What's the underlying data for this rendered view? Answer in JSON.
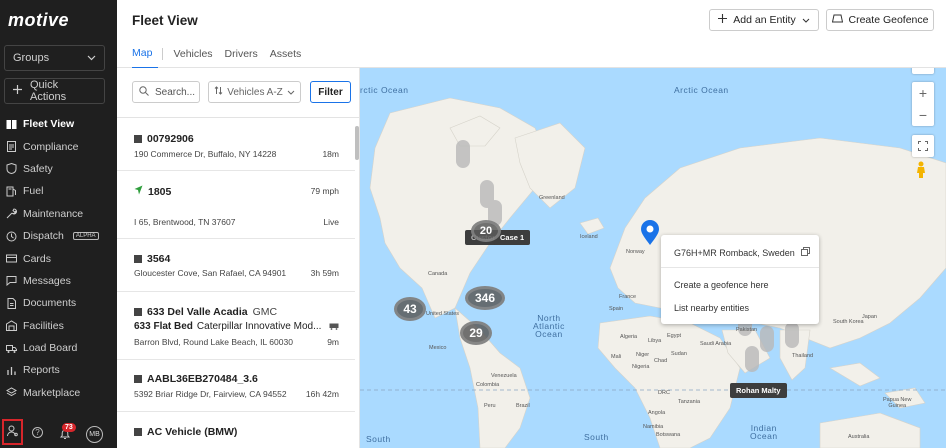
{
  "sidebar": {
    "logo": "motive",
    "groups_label": "Groups",
    "quick_actions_label": "Quick Actions",
    "items": [
      {
        "label": "Fleet View",
        "icon": "map-book-icon",
        "active": true
      },
      {
        "label": "Compliance",
        "icon": "document-icon"
      },
      {
        "label": "Safety",
        "icon": "shield-icon"
      },
      {
        "label": "Fuel",
        "icon": "fuel-icon"
      },
      {
        "label": "Maintenance",
        "icon": "wrench-icon"
      },
      {
        "label": "Dispatch",
        "icon": "dispatch-icon",
        "badge": "ALPHA"
      },
      {
        "label": "Cards",
        "icon": "card-icon"
      },
      {
        "label": "Messages",
        "icon": "message-icon"
      },
      {
        "label": "Documents",
        "icon": "file-icon"
      },
      {
        "label": "Facilities",
        "icon": "facility-icon"
      },
      {
        "label": "Load Board",
        "icon": "truck-icon"
      },
      {
        "label": "Reports",
        "icon": "report-icon"
      },
      {
        "label": "Marketplace",
        "icon": "marketplace-icon"
      }
    ],
    "notifications_count": "73",
    "avatar_initials": "MB",
    "help_glyph": "?"
  },
  "header": {
    "title": "Fleet View",
    "add_entity_label": "Add an Entity",
    "create_geofence_label": "Create Geofence",
    "tabs": [
      {
        "label": "Map",
        "active": true
      },
      {
        "label": "Vehicles"
      },
      {
        "label": "Drivers"
      },
      {
        "label": "Assets"
      }
    ]
  },
  "list": {
    "search_placeholder": "Search...",
    "sort_label": "Vehicles A-Z",
    "filter_label": "Filter",
    "items": [
      {
        "name": "00792906",
        "address": "190 Commerce Dr, Buffalo, NY 14228",
        "status": "18m",
        "icon": "square-icon"
      },
      {
        "name": "1805",
        "speed": "79 mph",
        "address": "I 65, Brentwood, TN 37607",
        "status": "Live",
        "icon": "navigation-arrow-icon"
      },
      {
        "name": "3564",
        "address": "Gloucester Cove, San Rafael, CA 94901",
        "status": "3h 59m",
        "icon": "square-icon"
      },
      {
        "name": "633 Del Valle Acadia",
        "make": "GMC",
        "asset_name": "633 Flat Bed",
        "asset_make": "Caterpillar Innovative Mod...",
        "address": "Barron Blvd, Round Lake Beach, IL 60030",
        "status": "9m",
        "icon": "square-icon"
      },
      {
        "name": "AABL36EB270484_3.6",
        "address": "5392 Briar Ridge Dr, Fairview, CA 94552",
        "status": "16h 42m",
        "icon": "square-icon"
      },
      {
        "name": "AC Vehicle (BMW)",
        "icon": "square-icon"
      }
    ]
  },
  "map": {
    "ocean_labels": {
      "arctic_left": "rctic Ocean",
      "arctic_center": "Arctic Ocean",
      "north_atlantic": "North\nAtlantic\nOcean",
      "south_pacific": "South",
      "south_atlantic": "South",
      "indian": "Indian\nOcean"
    },
    "country_labels": {
      "greenland": "Greenland",
      "iceland": "Iceland",
      "norway": "Norway",
      "canada": "Canada",
      "united_states": "United States",
      "mexico": "Mexico",
      "venezuela": "Venezuela",
      "colombia": "Colombia",
      "peru": "Peru",
      "brazil": "Brazil",
      "france": "France",
      "spain": "Spain",
      "algeria": "Algeria",
      "libya": "Libya",
      "egypt": "Egypt",
      "niger": "Niger",
      "chad": "Chad",
      "sudan": "Sudan",
      "nigeria": "Nigeria",
      "drc": "DRC",
      "tanzania": "Tanzania",
      "angola": "Angola",
      "namibia": "Namibia",
      "botswana": "Botswana",
      "saudi_arabia": "Saudi Arabia",
      "pakistan": "Pakistan",
      "thailand": "Thailand",
      "south_korea": "South Korea",
      "japan": "Japan",
      "australia": "Australia",
      "papua": "Papua New\nGuinea",
      "mali": "Mali"
    },
    "clusters": [
      {
        "count": "20"
      },
      {
        "count": "43"
      },
      {
        "count": "346"
      },
      {
        "count": "29"
      }
    ],
    "tags": {
      "case": "Case 1",
      "vehicle": "Rohan Malty",
      "partial": "Custom"
    },
    "popup": {
      "location": "G76H+MR Romback, Sweden",
      "action_geofence": "Create a geofence here",
      "action_nearby": "List nearby entities"
    },
    "zoom_in": "+",
    "zoom_out": "−"
  },
  "colors": {
    "sidebar_bg": "#1f1f1f",
    "accent": "#1a73e8",
    "alert": "#d7262b",
    "ocean": "#aadaff",
    "land": "#f2f0ea",
    "cluster": "#5a5a5a",
    "live_arrow": "#2e9e3c"
  }
}
